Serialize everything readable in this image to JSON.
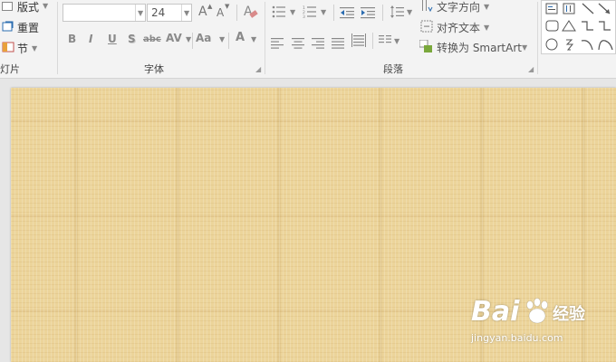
{
  "slides_group": {
    "layout_label": "版式",
    "reset_label": "重置",
    "section_label": "节",
    "group_label": "灯片"
  },
  "font_group": {
    "font_name_value": "",
    "font_size_value": "24",
    "grow_font": "A",
    "shrink_font": "A",
    "clear_format": "A",
    "bold": "B",
    "italic": "I",
    "underline": "U",
    "shadow": "S",
    "strikethrough": "abc",
    "char_spacing": "AV",
    "change_case": "Aa",
    "font_color": "A",
    "group_label": "字体"
  },
  "paragraph_group": {
    "text_direction_label": "文字方向",
    "align_text_label": "对齐文本",
    "convert_smartart_label": "转换为 SmartArt",
    "group_label": "段落"
  },
  "watermark": {
    "brand": "Bai",
    "brand_suffix": "经验",
    "url": "jingyan.baidu.com"
  }
}
